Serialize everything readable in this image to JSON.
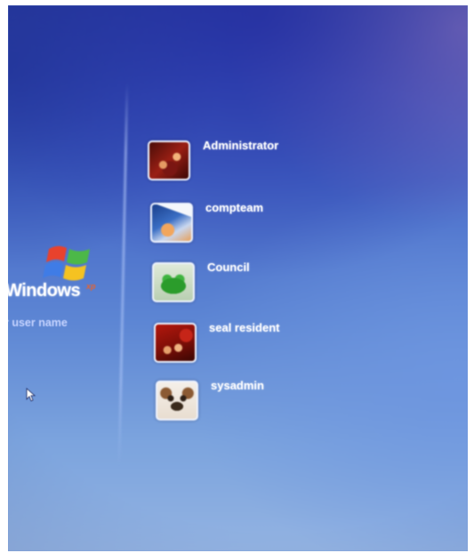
{
  "brand": {
    "word": "Windows",
    "edition": "xp"
  },
  "login": {
    "instruction": "r user name"
  },
  "users": [
    {
      "name": "Administrator"
    },
    {
      "name": "compteam"
    },
    {
      "name": "Council"
    },
    {
      "name": "seal resident"
    },
    {
      "name": "sysadmin"
    }
  ],
  "colors": {
    "background_top": "#2e45ad",
    "background_bottom": "#93b3e2",
    "text": "#ffffff",
    "instruction_text": "#c7d4ff",
    "logo_red": "#e8422d",
    "logo_green": "#4cb848",
    "logo_blue": "#3f7ce6",
    "logo_yellow": "#f5c221"
  },
  "icons": {
    "logo": "windows-flag-logo-icon",
    "cursor": "mouse-pointer-icon"
  }
}
